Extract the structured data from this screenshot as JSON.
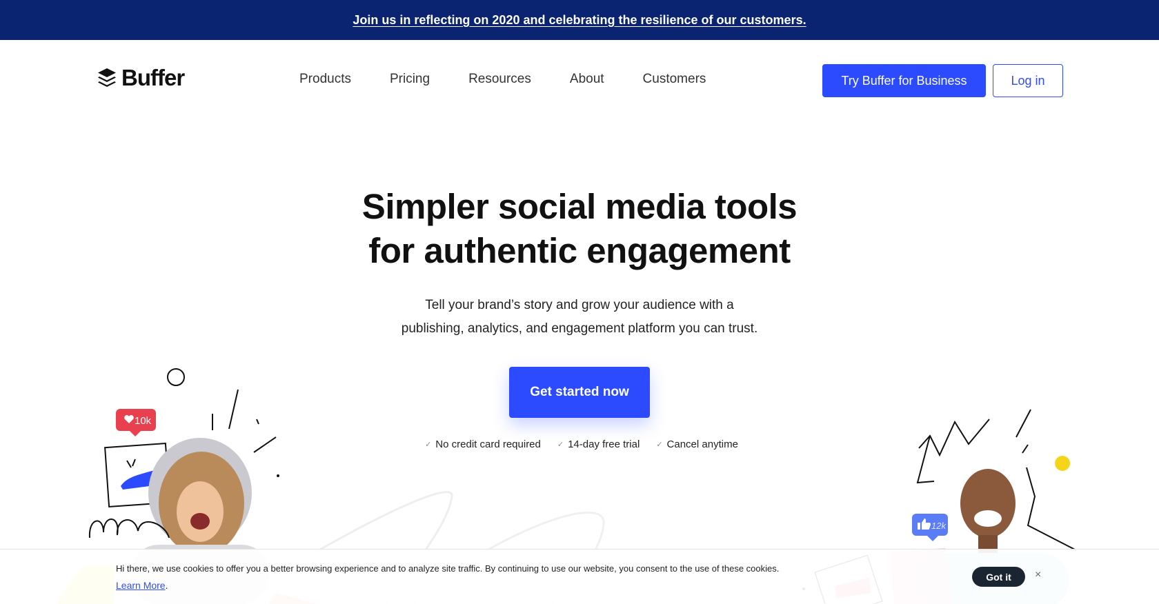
{
  "banner": {
    "text": "Join us in reflecting on 2020 and celebrating the resilience of our customers."
  },
  "nav": {
    "logo_text": "Buffer",
    "menu": [
      "Products",
      "Pricing",
      "Resources",
      "About",
      "Customers"
    ],
    "business_button": "Try Buffer for Business",
    "login_button": "Log in"
  },
  "hero": {
    "title_line1": "Simpler social media tools",
    "title_line2": "for authentic engagement",
    "subtitle_line1": "Tell your brand’s story and grow your audience with a",
    "subtitle_line2": "publishing, analytics, and engagement platform you can trust.",
    "cta": "Get started now",
    "checks": [
      "No credit card required",
      "14-day free trial",
      "Cancel anytime"
    ]
  },
  "illustration": {
    "like_badge": "10k",
    "thumb_badge": "12k",
    "colors": {
      "like_badge": "#e8404f",
      "thumb_badge": "#5b7cf7",
      "dot": "#f5d51a",
      "shoe": "#2c4bff"
    }
  },
  "cookie": {
    "text": "Hi there, we use cookies to offer you a better browsing experience and to analyze site traffic. By continuing to use our website, you consent to the use of these cookies.",
    "link": "Learn More",
    "button": "Got it",
    "close": "×"
  },
  "colors": {
    "banner_bg": "#0a2472",
    "primary": "#2c4bff",
    "cookie_button": "#1b2431"
  }
}
